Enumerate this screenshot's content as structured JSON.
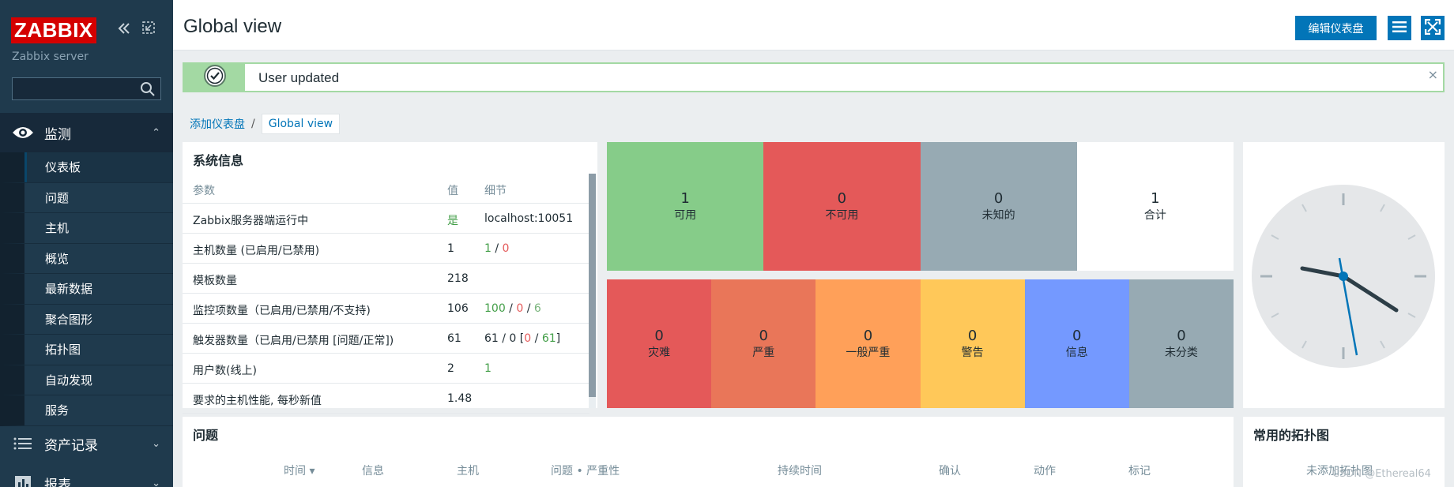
{
  "sidebar": {
    "logo": "ZABBIX",
    "server_name": "Zabbix server",
    "search": {
      "value": "",
      "placeholder": ""
    },
    "sections": {
      "monitoring": {
        "label": "监测",
        "expanded": true
      },
      "inventory": {
        "label": "资产记录"
      },
      "reports": {
        "label": "报表"
      }
    },
    "submenu": [
      {
        "label": "仪表板",
        "active": true
      },
      {
        "label": "问题"
      },
      {
        "label": "主机"
      },
      {
        "label": "概览"
      },
      {
        "label": "最新数据"
      },
      {
        "label": "聚合图形"
      },
      {
        "label": "拓扑图"
      },
      {
        "label": "自动发现"
      },
      {
        "label": "服务"
      }
    ]
  },
  "header": {
    "title": "Global view",
    "edit_button": "编辑仪表盘"
  },
  "message": {
    "text": "User updated",
    "close": "×"
  },
  "breadcrumb": {
    "parent": "添加仪表盘",
    "separator": "/",
    "current": "Global view"
  },
  "system_info": {
    "title": "系统信息",
    "columns": {
      "param": "参数",
      "value": "值",
      "details": "细节"
    },
    "rows": [
      {
        "param": "Zabbix服务器端运行中",
        "value": "是",
        "details": "localhost:10051"
      },
      {
        "param": "主机数量 (已启用/已禁用)",
        "value": "1",
        "d1": "1",
        "d2": "0"
      },
      {
        "param": "模板数量",
        "value": "218"
      },
      {
        "param": "监控项数量（已启用/已禁用/不支持)",
        "value": "106",
        "d1": "100",
        "d2": "0",
        "d3": "6"
      },
      {
        "param": "触发器数量（已启用/已禁用 [问题/正常])",
        "value": "61",
        "d_prefix": "61 / 0 [",
        "d1": "0",
        "d2": "61",
        "d_suffix": "]"
      },
      {
        "param": "用户数(线上)",
        "value": "2",
        "d1": "1"
      },
      {
        "param": "要求的主机性能, 每秒新值",
        "value": "1.48"
      }
    ]
  },
  "host_availability": [
    {
      "count": "1",
      "label": "可用",
      "color": "#86cc89"
    },
    {
      "count": "0",
      "label": "不可用",
      "color": "#e45959"
    },
    {
      "count": "0",
      "label": "未知的",
      "color": "#97aab3"
    },
    {
      "count": "1",
      "label": "合计",
      "color": "#ffffff"
    }
  ],
  "problems_by_severity": [
    {
      "count": "0",
      "label": "灾难",
      "color": "#e45959"
    },
    {
      "count": "0",
      "label": "严重",
      "color": "#e97659"
    },
    {
      "count": "0",
      "label": "一般严重",
      "color": "#ffa059"
    },
    {
      "count": "0",
      "label": "警告",
      "color": "#ffc859"
    },
    {
      "count": "0",
      "label": "信息",
      "color": "#7499ff"
    },
    {
      "count": "0",
      "label": "未分类",
      "color": "#97aab3"
    }
  ],
  "problems": {
    "title": "问题",
    "columns": [
      "时间 ▾",
      "信息",
      "主机",
      "问题 • 严重性",
      "持续时间",
      "确认",
      "动作",
      "标记"
    ]
  },
  "maps": {
    "title": "常用的拓扑图",
    "empty": "未添加拓扑图"
  },
  "watermark": "CSDN @Ethereal64"
}
